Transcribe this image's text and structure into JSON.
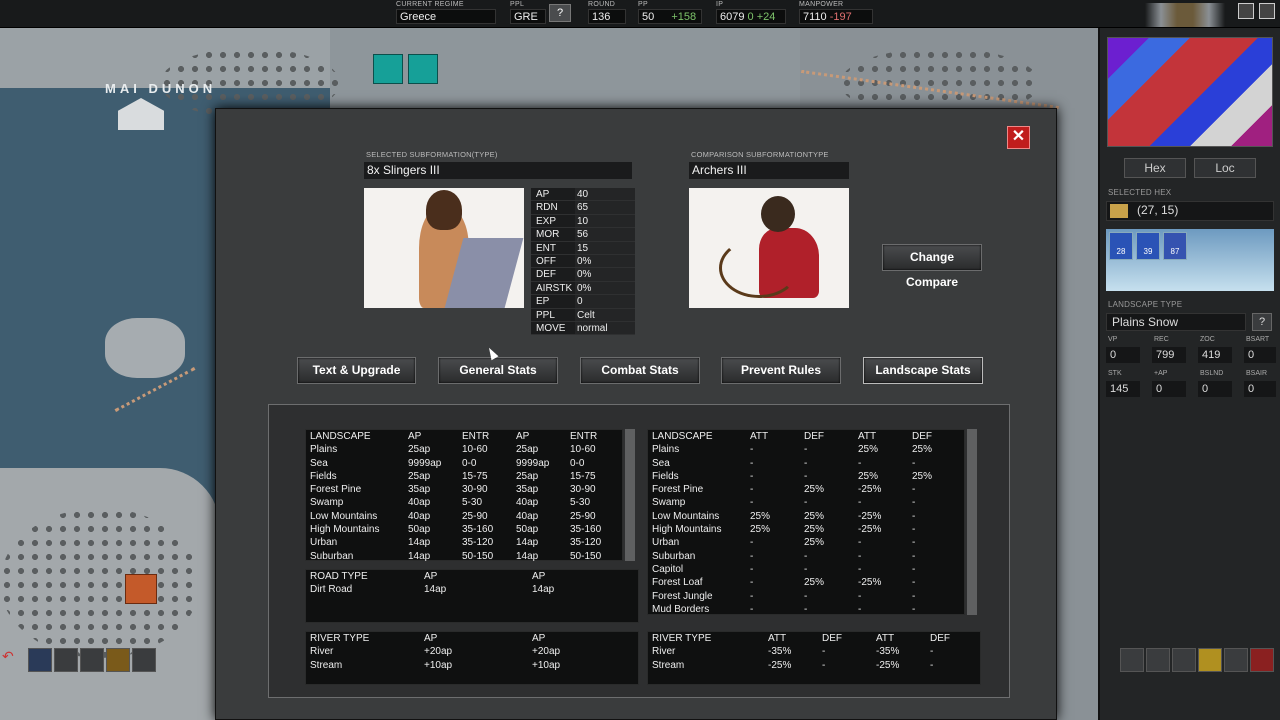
{
  "topbar": {
    "current_regime": {
      "label": "CURRENT REGIME",
      "value": "Greece"
    },
    "ppl": {
      "label": "PPL",
      "value": "GRE",
      "help": "?"
    },
    "round": {
      "label": "ROUND",
      "value": "136"
    },
    "pp": {
      "label": "PP",
      "value": "50",
      "delta": "+158"
    },
    "ip": {
      "label": "IP",
      "value": "6079",
      "delta": "0 +24"
    },
    "manpower": {
      "label": "MANPOWER",
      "value": "7110",
      "delta": "-197"
    }
  },
  "map": {
    "place_label": "MAI DUNON"
  },
  "right_panel": {
    "hex_button": "Hex",
    "loc_button": "Loc",
    "selected_hex_label": "SELECTED HEX",
    "selected_hex_value": "(27, 15)",
    "units": [
      "28",
      "39",
      "87"
    ],
    "landscape_type_label": "LANDSCAPE TYPE",
    "landscape_type_value": "Plains Snow",
    "help": "?",
    "stats": [
      {
        "label": "VP",
        "value": "0"
      },
      {
        "label": "REC",
        "value": "799"
      },
      {
        "label": "ZOC",
        "value": "419"
      },
      {
        "label": "BSART",
        "value": "0"
      },
      {
        "label": "STK",
        "value": "145"
      },
      {
        "label": "+AP",
        "value": "0"
      },
      {
        "label": "BSLND",
        "value": "0"
      },
      {
        "label": "BSAIR",
        "value": "0"
      }
    ]
  },
  "dialog": {
    "close_label": "✕",
    "selected_label": "SELECTED SUBFORMATION(TYPE)",
    "selected_name": "8x Slingers III",
    "comparison_label": "COMPARISON SUBFORMATIONTYPE",
    "comparison_name": "Archers III",
    "change_compare": "Change Compare",
    "stats": [
      {
        "k": "AP",
        "v": "40"
      },
      {
        "k": "RDN",
        "v": "65"
      },
      {
        "k": "EXP",
        "v": "10"
      },
      {
        "k": "MOR",
        "v": "56"
      },
      {
        "k": "ENT",
        "v": "15"
      },
      {
        "k": "OFF",
        "v": "0%"
      },
      {
        "k": "DEF",
        "v": "0%"
      },
      {
        "k": "AIRSTK",
        "v": "0%"
      },
      {
        "k": "EP",
        "v": "0"
      },
      {
        "k": "PPL",
        "v": "Celt"
      },
      {
        "k": "MOVE",
        "v": "normal"
      }
    ],
    "tabs": [
      "Text & Upgrade",
      "General Stats",
      "Combat Stats",
      "Prevent Rules",
      "Landscape Stats"
    ],
    "active_tab": "Landscape Stats",
    "move_table": {
      "headers": [
        "LANDSCAPE",
        "AP",
        "ENTR",
        "AP",
        "ENTR"
      ],
      "rows": [
        [
          "Plains",
          "25ap",
          "10-60",
          "25ap",
          "10-60"
        ],
        [
          "Sea",
          "9999ap",
          "0-0",
          "9999ap",
          "0-0"
        ],
        [
          "Fields",
          "25ap",
          "15-75",
          "25ap",
          "15-75"
        ],
        [
          "Forest Pine",
          "35ap",
          "30-90",
          "35ap",
          "30-90"
        ],
        [
          "Swamp",
          "40ap",
          "5-30",
          "40ap",
          "5-30"
        ],
        [
          "Low Mountains",
          "40ap",
          "25-90",
          "40ap",
          "25-90"
        ],
        [
          "High Mountains",
          "50ap",
          "35-160",
          "50ap",
          "35-160"
        ],
        [
          "Urban",
          "14ap",
          "35-120",
          "14ap",
          "35-120"
        ],
        [
          "Suburban",
          "14ap",
          "50-150",
          "14ap",
          "50-150"
        ]
      ]
    },
    "combat_table": {
      "headers": [
        "LANDSCAPE",
        "ATT",
        "DEF",
        "ATT",
        "DEF"
      ],
      "rows": [
        [
          "Plains",
          "-",
          "-",
          "25%",
          "25%"
        ],
        [
          "Sea",
          "-",
          "-",
          "-",
          "-"
        ],
        [
          "Fields",
          "-",
          "-",
          "25%",
          "25%"
        ],
        [
          "Forest Pine",
          "-",
          "25%",
          "-25%",
          "-"
        ],
        [
          "Swamp",
          "-",
          "-",
          "-",
          "-"
        ],
        [
          "Low Mountains",
          "25%",
          "25%",
          "-25%",
          "-"
        ],
        [
          "High Mountains",
          "25%",
          "25%",
          "-25%",
          "-"
        ],
        [
          "Urban",
          "-",
          "25%",
          "-",
          "-"
        ],
        [
          "Suburban",
          "-",
          "-",
          "-",
          "-"
        ],
        [
          "Capitol",
          "-",
          "-",
          "-",
          "-"
        ],
        [
          "Forest Loaf",
          "-",
          "25%",
          "-25%",
          "-"
        ],
        [
          "Forest Jungle",
          "-",
          "-",
          "-",
          "-"
        ],
        [
          "Mud Borders",
          "-",
          "-",
          "-",
          "-"
        ]
      ]
    },
    "road_table": {
      "headers": [
        "ROAD TYPE",
        "AP",
        "AP"
      ],
      "rows": [
        [
          "Dirt Road",
          "14ap",
          "14ap"
        ]
      ]
    },
    "river_move_table": {
      "headers": [
        "RIVER TYPE",
        "AP",
        "AP"
      ],
      "rows": [
        [
          "River",
          "+20ap",
          "+20ap"
        ],
        [
          "Stream",
          "+10ap",
          "+10ap"
        ]
      ]
    },
    "river_combat_table": {
      "headers": [
        "RIVER TYPE",
        "ATT",
        "DEF",
        "ATT",
        "DEF"
      ],
      "rows": [
        [
          "River",
          "-35%",
          "-",
          "-35%",
          "-"
        ],
        [
          "Stream",
          "-25%",
          "-",
          "-25%",
          "-"
        ]
      ]
    }
  },
  "colors": {
    "close_red": "#c01d1d",
    "panel_bg": "#3a3c3d",
    "pp_delta": "#7ec46b",
    "manpower_delta": "#e07070"
  }
}
